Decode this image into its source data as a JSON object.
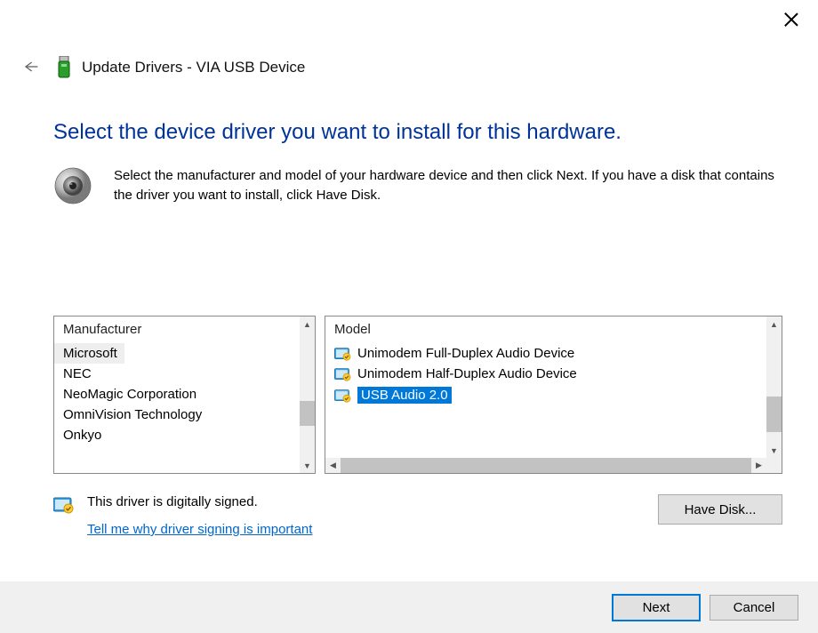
{
  "window": {
    "title": "Update Drivers - VIA USB Device"
  },
  "heading": "Select the device driver you want to install for this hardware.",
  "description": "Select the manufacturer and model of your hardware device and then click Next. If you have a disk that contains the driver you want to install, click Have Disk.",
  "manufacturer": {
    "header": "Manufacturer",
    "items": [
      "Microsoft",
      "NEC",
      "NeoMagic Corporation",
      "OmniVision Technology",
      "Onkyo"
    ],
    "selected_index": 0
  },
  "model": {
    "header": "Model",
    "items": [
      "Unimodem Full-Duplex Audio Device",
      "Unimodem Half-Duplex Audio Device",
      "USB Audio 2.0"
    ],
    "selected_index": 2
  },
  "signed": {
    "status": "This driver is digitally signed.",
    "link": "Tell me why driver signing is important"
  },
  "buttons": {
    "have_disk": "Have Disk...",
    "next": "Next",
    "cancel": "Cancel"
  }
}
